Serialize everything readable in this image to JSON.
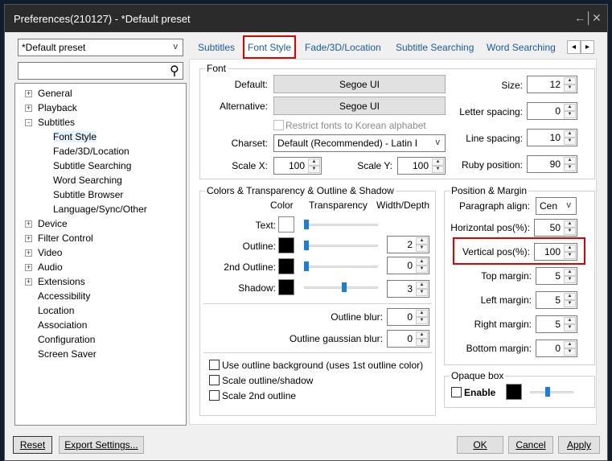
{
  "window": {
    "title": "Preferences(210127) - *Default preset",
    "pin_glyph": "←│",
    "close_glyph": "✕"
  },
  "preset": {
    "selected": "*Default preset"
  },
  "search": {
    "placeholder": ""
  },
  "tree": {
    "items": [
      {
        "label": "General",
        "expandable": true,
        "child": false
      },
      {
        "label": "Playback",
        "expandable": true,
        "child": false
      },
      {
        "label": "Subtitles",
        "expandable": true,
        "expanded": true,
        "child": false
      },
      {
        "label": "Font Style",
        "child": true,
        "selected": true
      },
      {
        "label": "Fade/3D/Location",
        "child": true
      },
      {
        "label": "Subtitle Searching",
        "child": true
      },
      {
        "label": "Word Searching",
        "child": true
      },
      {
        "label": "Subtitle Browser",
        "child": true
      },
      {
        "label": "Language/Sync/Other",
        "child": true
      },
      {
        "label": "Device",
        "expandable": true,
        "child": false
      },
      {
        "label": "Filter Control",
        "expandable": true,
        "child": false
      },
      {
        "label": "Video",
        "expandable": true,
        "child": false
      },
      {
        "label": "Audio",
        "expandable": true,
        "child": false
      },
      {
        "label": "Extensions",
        "expandable": true,
        "child": false
      },
      {
        "label": "Accessibility",
        "child": false
      },
      {
        "label": "Location",
        "child": false
      },
      {
        "label": "Association",
        "child": false
      },
      {
        "label": "Configuration",
        "child": false
      },
      {
        "label": "Screen Saver",
        "child": false
      }
    ]
  },
  "tabs": [
    {
      "label": "Subtitles"
    },
    {
      "label": "Font Style",
      "active": true
    },
    {
      "label": "Fade/3D/Location"
    },
    {
      "label": "Subtitle Searching"
    },
    {
      "label": "Word Searching"
    }
  ],
  "tab_scroll": {
    "left": "◂",
    "right": "▸"
  },
  "font": {
    "group_label": "Font",
    "default_label": "Default:",
    "default_value": "Segoe UI",
    "alternative_label": "Alternative:",
    "alternative_value": "Segoe UI",
    "restrict_label": "Restrict fonts to Korean alphabet",
    "charset_label": "Charset:",
    "charset_value": "Default (Recommended) - Latin I",
    "scalex_label": "Scale X:",
    "scalex_value": "100",
    "scaley_label": "Scale Y:",
    "scaley_value": "100",
    "size_label": "Size:",
    "size_value": "12",
    "letter_label": "Letter spacing:",
    "letter_value": "0",
    "line_label": "Line spacing:",
    "line_value": "10",
    "ruby_label": "Ruby position:",
    "ruby_value": "90"
  },
  "colors": {
    "group_label": "Colors & Transparency & Outline & Shadow",
    "col_color": "Color",
    "col_transparency": "Transparency",
    "col_width": "Width/Depth",
    "text_label": "Text:",
    "text_color": "#ffffff",
    "text_transparency": 0,
    "outline_label": "Outline:",
    "outline_color": "#000000",
    "outline_transparency": 0,
    "outline_value": "2",
    "second_outline_label": "2nd Outline:",
    "second_outline_color": "#000000",
    "second_outline_transparency": 0,
    "second_outline_value": "0",
    "shadow_label": "Shadow:",
    "shadow_color": "#000000",
    "shadow_transparency": 0.55,
    "shadow_value": "3",
    "outline_blur_label": "Outline blur:",
    "outline_blur_value": "0",
    "gauss_blur_label": "Outline gaussian blur:",
    "gauss_blur_value": "0",
    "use_bg_label": "Use outline background (uses 1st outline color)",
    "scale_outline_label": "Scale outline/shadow",
    "scale_second_label": "Scale 2nd outline"
  },
  "position": {
    "group_label": "Position & Margin",
    "para_label": "Paragraph align:",
    "para_value": "Cen",
    "hpos_label": "Horizontal pos(%):",
    "hpos_value": "50",
    "vpos_label": "Vertical pos(%):",
    "vpos_value": "100",
    "top_label": "Top margin:",
    "top_value": "5",
    "left_label": "Left margin:",
    "left_value": "5",
    "right_label": "Right margin:",
    "right_value": "5",
    "bottom_label": "Bottom margin:",
    "bottom_value": "0"
  },
  "opaque": {
    "group_label": "Opaque box",
    "enable_label": "Enable",
    "color": "#000000",
    "level": 0.4
  },
  "footer": {
    "reset": "Reset",
    "export": "Export Settings...",
    "ok": "OK",
    "cancel": "Cancel",
    "apply": "Apply"
  },
  "glyphs": {
    "search": "⚲",
    "dropdown": "v",
    "up": "▲",
    "down": "▼",
    "minus": "-",
    "plus": "+"
  },
  "accent": "#e00000"
}
